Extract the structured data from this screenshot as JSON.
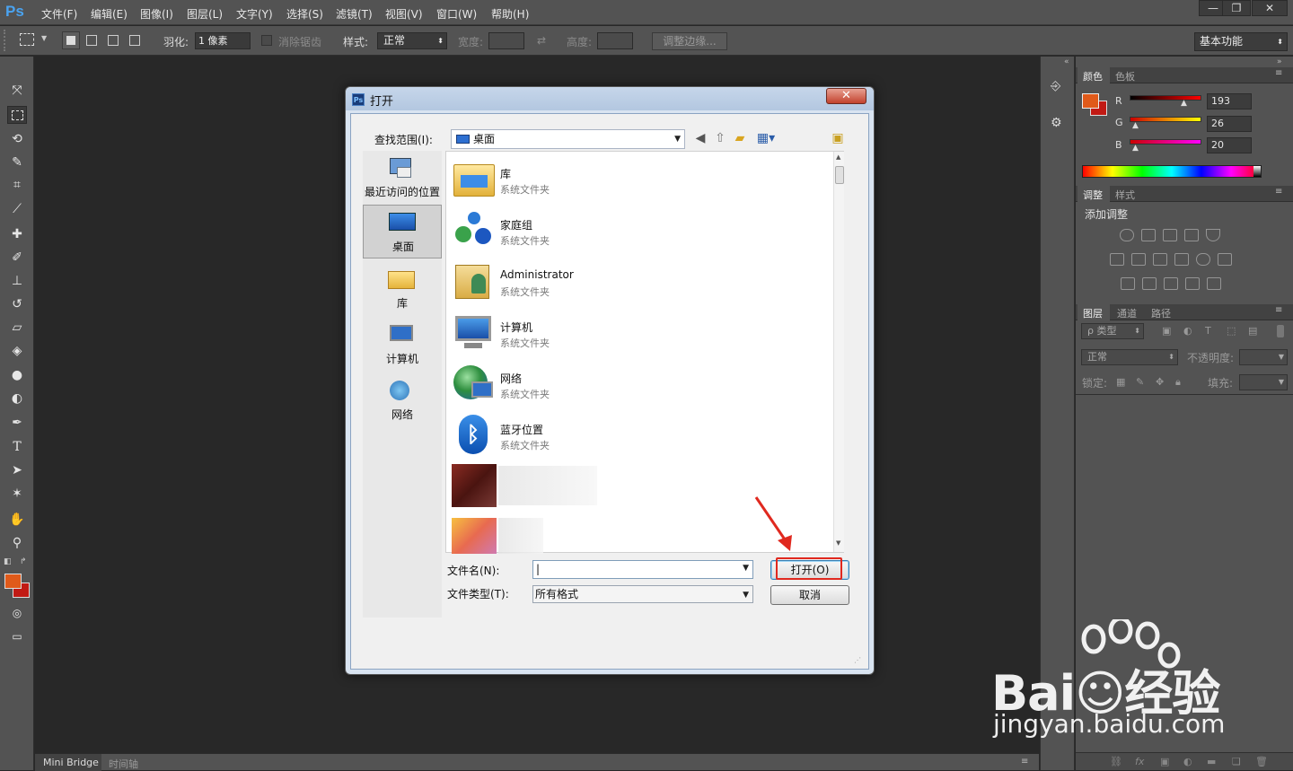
{
  "app": {
    "logo": "Ps"
  },
  "menu": [
    "文件(F)",
    "编辑(E)",
    "图像(I)",
    "图层(L)",
    "文字(Y)",
    "选择(S)",
    "滤镜(T)",
    "视图(V)",
    "窗口(W)",
    "帮助(H)"
  ],
  "window_controls": {
    "minimize": "—",
    "restore": "❐",
    "close": "✕"
  },
  "options": {
    "feather_label": "羽化:",
    "feather_value": "1 像素",
    "antialias_label": "消除锯齿",
    "style_label": "样式:",
    "style_value": "正常",
    "width_label": "宽度:",
    "height_label": "高度:",
    "refine_edge": "调整边缘...",
    "workspace": "基本功能"
  },
  "bottom_tabs": [
    "Mini Bridge",
    "时间轴"
  ],
  "color_panel": {
    "tabs": [
      "颜色",
      "色板"
    ],
    "channels": [
      {
        "label": "R",
        "value": "193"
      },
      {
        "label": "G",
        "value": "26"
      },
      {
        "label": "B",
        "value": "20"
      }
    ],
    "foreground": "#c11a14",
    "background": "#c11a14",
    "accent": "#e05a1a"
  },
  "adjust_panel": {
    "tabs": [
      "调整",
      "样式"
    ],
    "title": "添加调整"
  },
  "layers_panel": {
    "tabs": [
      "图层",
      "通道",
      "路径"
    ],
    "filter_label": "ρ 类型",
    "blend_mode": "正常",
    "opacity_label": "不透明度:",
    "lock_label": "锁定:",
    "fill_label": "填充:"
  },
  "dialog": {
    "title": "打开",
    "lookin_label": "查找范围(I):",
    "lookin_value": "桌面",
    "places": [
      "最近访问的位置",
      "桌面",
      "库",
      "计算机",
      "网络"
    ],
    "files": [
      {
        "name": "库",
        "type": "系统文件夹"
      },
      {
        "name": "家庭组",
        "type": "系统文件夹"
      },
      {
        "name": "Administrator",
        "type": "系统文件夹"
      },
      {
        "name": "计算机",
        "type": "系统文件夹"
      },
      {
        "name": "网络",
        "type": "系统文件夹"
      },
      {
        "name": "蓝牙位置",
        "type": "系统文件夹"
      }
    ],
    "filename_label": "文件名(N):",
    "filename_value": "",
    "filetype_label": "文件类型(T):",
    "filetype_value": "所有格式",
    "open_button": "打开(O)",
    "cancel_button": "取消",
    "close": "✕"
  },
  "watermark": {
    "brand": "Bai☺经验",
    "url": "jingyan.baidu.com"
  }
}
